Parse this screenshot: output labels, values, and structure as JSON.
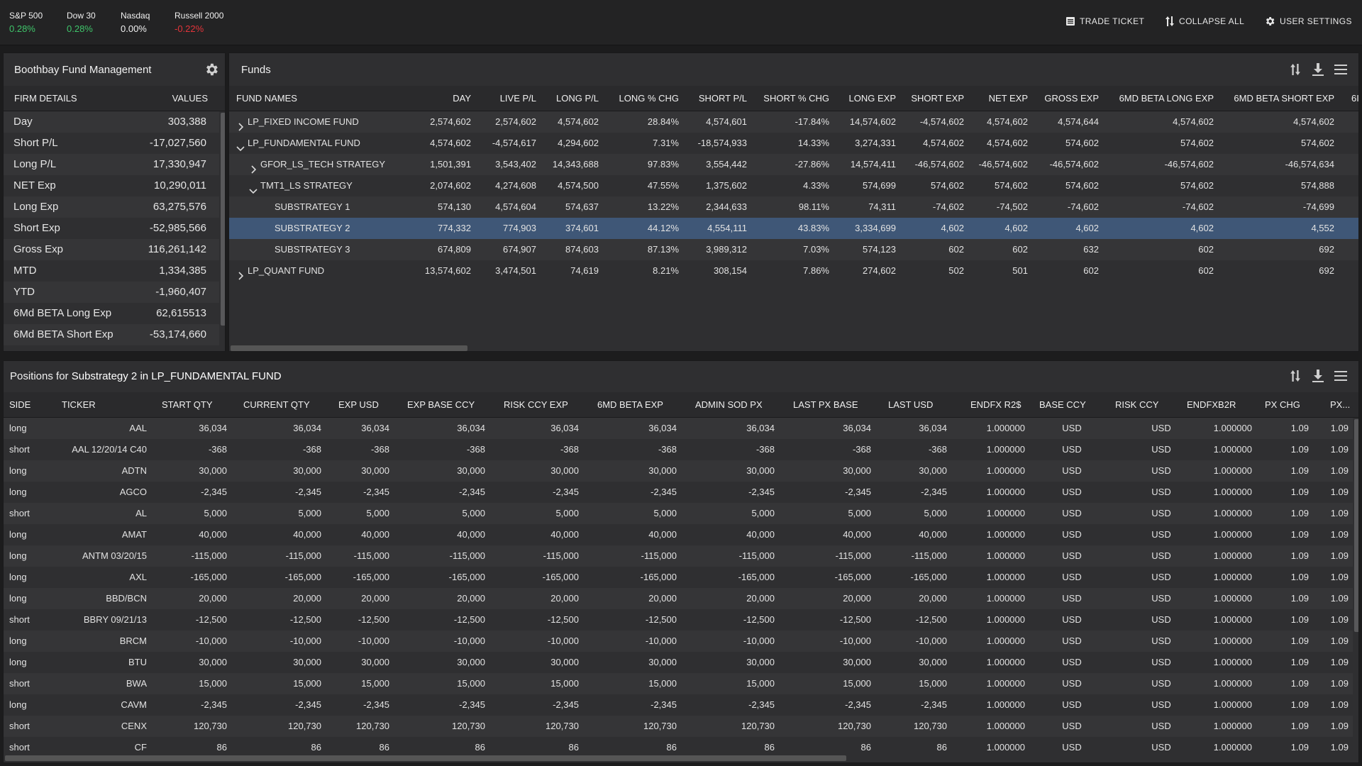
{
  "indices": [
    {
      "name": "S&P 500",
      "change": "0.28%",
      "dir": "pos"
    },
    {
      "name": "Dow 30",
      "change": "0.28%",
      "dir": "pos"
    },
    {
      "name": "Nasdaq",
      "change": "0.00%",
      "dir": "flat"
    },
    {
      "name": "Russell 2000",
      "change": "-0.22%",
      "dir": "neg"
    }
  ],
  "toolbar": {
    "trade_ticket": "TRADE TICKET",
    "collapse_all": "COLLAPSE ALL",
    "user_settings": "USER SETTINGS"
  },
  "firm": {
    "title": "Boothbay Fund Management",
    "col_details": "FIRM DETAILS",
    "col_values": "VALUES",
    "rows": [
      {
        "k": "Day",
        "v": "303,388"
      },
      {
        "k": "Short P/L",
        "v": "-17,027,560"
      },
      {
        "k": "Long P/L",
        "v": "17,330,947"
      },
      {
        "k": "NET Exp",
        "v": "10,290,011"
      },
      {
        "k": "Long Exp",
        "v": "63,275,576"
      },
      {
        "k": "Short Exp",
        "v": "-52,985,566"
      },
      {
        "k": "Gross Exp",
        "v": "116,261,142"
      },
      {
        "k": "MTD",
        "v": "1,334,385"
      },
      {
        "k": "YTD",
        "v": "-1,960,407"
      },
      {
        "k": "6Md BETA Long Exp",
        "v": "62,615513"
      },
      {
        "k": "6Md BETA Short Exp",
        "v": "-53,174,660"
      }
    ]
  },
  "funds": {
    "title": "Funds",
    "columns": [
      "FUND NAMES",
      "DAY",
      "LIVE P/L",
      "LONG P/L",
      "LONG % CHG",
      "SHORT P/L",
      "SHORT % CHG",
      "LONG EXP",
      "SHORT EXP",
      "NET EXP",
      "GROSS EXP",
      "6MD BETA LONG EXP",
      "6MD BETA SHORT EXP",
      "6I"
    ],
    "rows": [
      {
        "name": "LP_FIXED INCOME FUND",
        "level": 0,
        "chev": "right",
        "cells": [
          "2,574,602",
          "2,574,602",
          "4,574,602",
          "28.84%",
          "4,574,601",
          "-17.84%",
          "14,574,602",
          "-4,574,602",
          "4,574,602",
          "4,574,644",
          "4,574,602",
          "4,574,602"
        ]
      },
      {
        "name": "LP_FUNDAMENTAL FUND",
        "level": 0,
        "chev": "down",
        "cells": [
          "4,574,602",
          "-4,574,617",
          "4,294,602",
          "7.31%",
          "-18,574,933",
          "14.33%",
          "3,274,331",
          "4,574,602",
          "4,574,602",
          "574,602",
          "574,602",
          "574,602"
        ]
      },
      {
        "name": "GFOR_LS_TECH STRATEGY",
        "level": 1,
        "chev": "right",
        "cells": [
          "1,501,391",
          "3,543,402",
          "14,343,688",
          "97.83%",
          "3,554,442",
          "-27.86%",
          "14,574,411",
          "-46,574,602",
          "-46,574,602",
          "-46,574,602",
          "-46,574,602",
          "-46,574,634"
        ]
      },
      {
        "name": "TMT1_LS STRATEGY",
        "level": 1,
        "chev": "down",
        "cells": [
          "2,074,602",
          "4,274,608",
          "4,574,500",
          "47.55%",
          "1,375,602",
          "4.33%",
          "574,699",
          "574,602",
          "574,602",
          "574,602",
          "574,602",
          "574,888"
        ]
      },
      {
        "name": "SUBSTRATEGY 1",
        "level": 2,
        "chev": "",
        "cells": [
          "574,130",
          "4,574,604",
          "574,637",
          "13.22%",
          "2,344,633",
          "98.11%",
          "74,311",
          "-74,602",
          "-74,502",
          "-74,602",
          "-74,602",
          "-74,699"
        ]
      },
      {
        "name": "SUBSTRATEGY 2",
        "level": 2,
        "chev": "",
        "selected": true,
        "cells": [
          "774,332",
          "774,903",
          "374,601",
          "44.12%",
          "4,554,111",
          "43.83%",
          "3,334,699",
          "4,602",
          "4,602",
          "4,602",
          "4,602",
          "4,552"
        ]
      },
      {
        "name": "SUBSTRATEGY 3",
        "level": 2,
        "chev": "",
        "cells": [
          "674,809",
          "674,907",
          "874,603",
          "87.13%",
          "3,989,312",
          "7.03%",
          "574,123",
          "602",
          "602",
          "632",
          "602",
          "692"
        ]
      },
      {
        "name": "LP_QUANT FUND",
        "level": 0,
        "chev": "right",
        "cells": [
          "13,574,602",
          "3,474,501",
          "74,619",
          "8.21%",
          "308,154",
          "7.86%",
          "274,602",
          "502",
          "501",
          "602",
          "602",
          "692"
        ]
      }
    ]
  },
  "positions": {
    "title_prefix": "Positions for ",
    "title_bold": "Substrategy 2 in LP_FUNDAMENTAL FUND",
    "columns": [
      "SIDE",
      "TICKER",
      "START QTY",
      "CURRENT QTY",
      "EXP USD",
      "EXP BASE CCY",
      "RISK CCY EXP",
      "6MD BETA EXP",
      "ADMIN SOD PX",
      "LAST PX BASE",
      "LAST USD",
      "ENDFX R2$",
      "BASE CCY",
      "RISK CCY",
      "ENDFXB2R",
      "PX CHG",
      "PX..."
    ],
    "rows": [
      {
        "side": "long",
        "ticker": "AAL",
        "q": "36,034"
      },
      {
        "side": "short",
        "ticker": "AAL 12/20/14 C40",
        "q": "-368"
      },
      {
        "side": "long",
        "ticker": "ADTN",
        "q": "30,000"
      },
      {
        "side": "long",
        "ticker": "AGCO",
        "q": "-2,345"
      },
      {
        "side": "short",
        "ticker": "AL",
        "q": "5,000"
      },
      {
        "side": "long",
        "ticker": "AMAT",
        "q": "40,000"
      },
      {
        "side": "long",
        "ticker": "ANTM 03/20/15",
        "q": "-115,000"
      },
      {
        "side": "long",
        "ticker": "AXL",
        "q": "-165,000"
      },
      {
        "side": "long",
        "ticker": "BBD/BCN",
        "q": "20,000"
      },
      {
        "side": "short",
        "ticker": "BBRY 09/21/13",
        "q": "-12,500"
      },
      {
        "side": "long",
        "ticker": "BRCM",
        "q": "-10,000"
      },
      {
        "side": "long",
        "ticker": "BTU",
        "q": "30,000"
      },
      {
        "side": "short",
        "ticker": "BWA",
        "q": "15,000"
      },
      {
        "side": "long",
        "ticker": "CAVM",
        "q": "-2,345"
      },
      {
        "side": "short",
        "ticker": "CENX",
        "q": "120,730"
      },
      {
        "side": "short",
        "ticker": "CF",
        "q": "86"
      }
    ],
    "fx_r2": "1.000000",
    "base_ccy": "USD",
    "risk_ccy": "USD",
    "fx_b2r": "1.000000",
    "px_chg": "1.09",
    "px_more": "1.09"
  }
}
